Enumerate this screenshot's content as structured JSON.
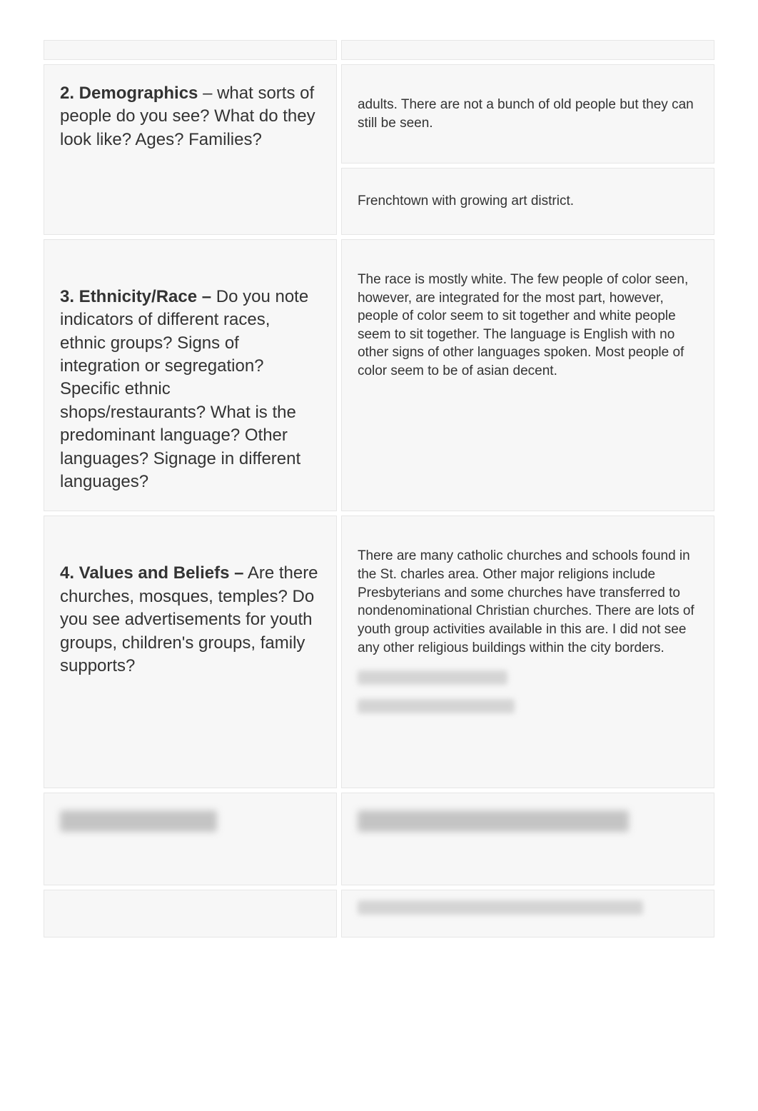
{
  "rows": {
    "r1": {
      "left_title": "2. Demographics",
      "left_rest": " – what sorts of people do you see? What do they look like? Ages? Families?",
      "right1": "adults. There are not a bunch of old people but they can still be seen.",
      "right2": "Frenchtown with growing art district."
    },
    "r2": {
      "left_title": "3. Ethnicity/Race –",
      "left_rest": " Do you note indicators of different races, ethnic groups? Signs of integration or segregation? Specific ethnic shops/restaurants? What is the predominant language? Other languages? Signage in different languages?",
      "right": " The race is mostly white. The few people of color seen, however, are integrated for the most part, however, people of color seem to sit together and white people seem to sit together. The language is English with no other signs of other languages spoken. Most people of color seem to be of asian decent."
    },
    "r3": {
      "left_title": "4. Values and Beliefs –",
      "left_rest": " Are there churches, mosques, temples? Do you see advertisements for youth groups, children's groups, family supports?",
      "right": " There are many catholic churches and schools found in the St. charles area. Other major religions include Presbyterians and some churches have transferred to nondenominational Christian churches. There are lots of youth group activities available in this are. I did not see any other religious buildings within the city borders."
    }
  }
}
